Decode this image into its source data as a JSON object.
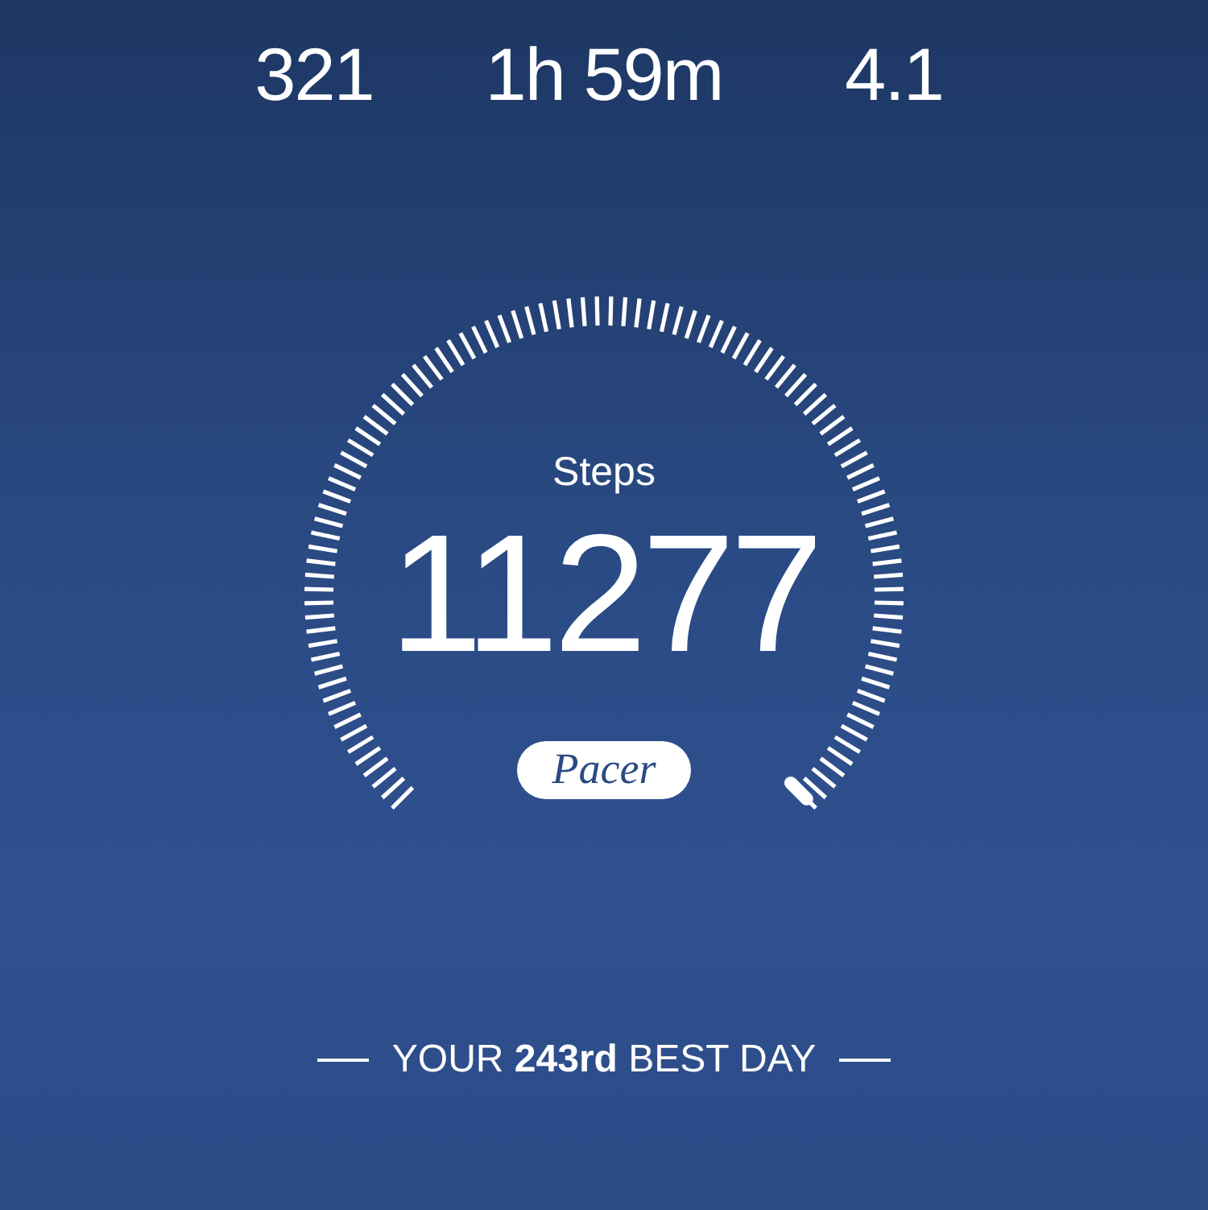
{
  "stats": [
    {
      "value": "321"
    },
    {
      "value": "1h 59m"
    },
    {
      "value": "4.1"
    }
  ],
  "gauge": {
    "label": "Steps",
    "value": "11277"
  },
  "logo": "Pacer",
  "rank": "YOUR **243rd** BEST DAY"
}
